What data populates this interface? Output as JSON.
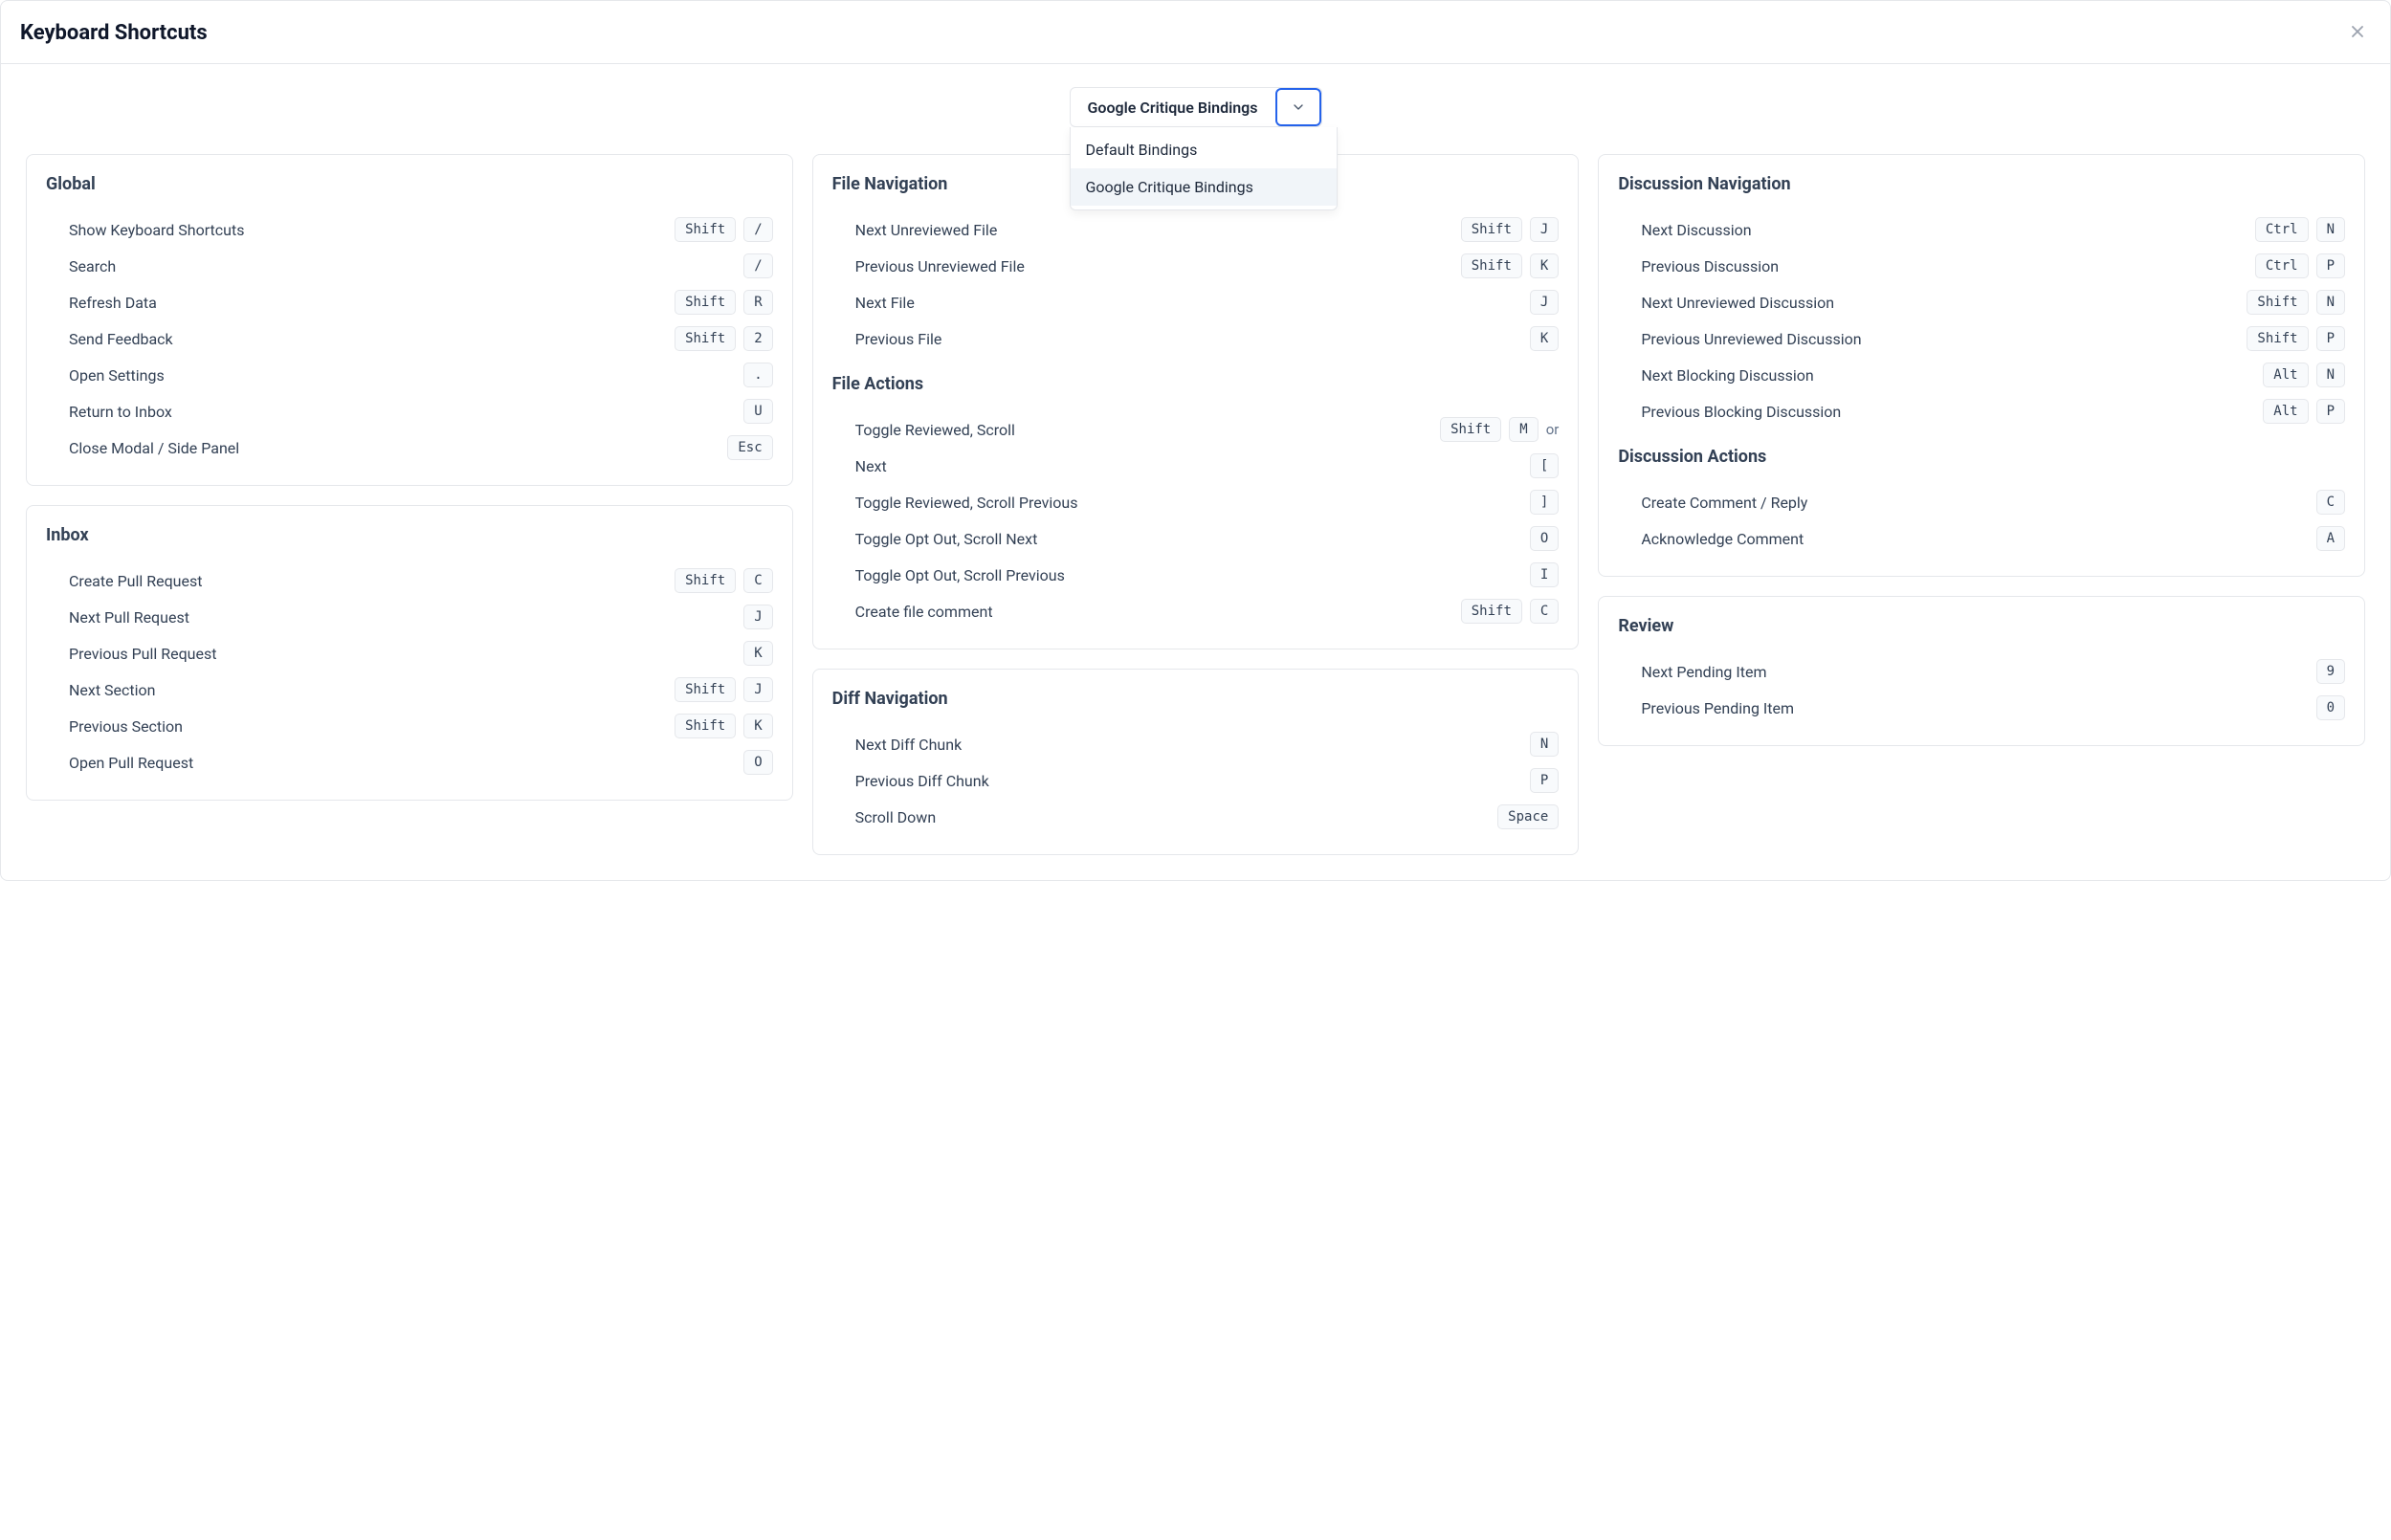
{
  "header": {
    "title": "Keyboard Shortcuts"
  },
  "dropdown": {
    "selected": "Google Critique Bindings",
    "options": [
      "Default Bindings",
      "Google Critique Bindings"
    ]
  },
  "columns": [
    [
      {
        "title": "Global",
        "rows": [
          {
            "label": "Show Keyboard Shortcuts",
            "keys": [
              "Shift",
              "/"
            ]
          },
          {
            "label": "Search",
            "keys": [
              "/"
            ]
          },
          {
            "label": "Refresh Data",
            "keys": [
              "Shift",
              "R"
            ]
          },
          {
            "label": "Send Feedback",
            "keys": [
              "Shift",
              "2"
            ]
          },
          {
            "label": "Open Settings",
            "keys": [
              "."
            ]
          },
          {
            "label": "Return to Inbox",
            "keys": [
              "U"
            ]
          },
          {
            "label": "Close Modal / Side Panel",
            "keys": [
              "Esc"
            ]
          }
        ]
      },
      {
        "title": "Inbox",
        "rows": [
          {
            "label": "Create Pull Request",
            "keys": [
              "Shift",
              "C"
            ]
          },
          {
            "label": "Next Pull Request",
            "keys": [
              "J"
            ]
          },
          {
            "label": "Previous Pull Request",
            "keys": [
              "K"
            ]
          },
          {
            "label": "Next Section",
            "keys": [
              "Shift",
              "J"
            ]
          },
          {
            "label": "Previous Section",
            "keys": [
              "Shift",
              "K"
            ]
          },
          {
            "label": "Open Pull Request",
            "keys": [
              "O"
            ]
          }
        ]
      }
    ],
    [
      {
        "groups": [
          {
            "title": "File Navigation",
            "rows": [
              {
                "label": "Next Unreviewed File",
                "keys": [
                  "Shift",
                  "J"
                ]
              },
              {
                "label": "Previous Unreviewed File",
                "keys": [
                  "Shift",
                  "K"
                ]
              },
              {
                "label": "Next File",
                "keys": [
                  "J"
                ]
              },
              {
                "label": "Previous File",
                "keys": [
                  "K"
                ]
              }
            ]
          },
          {
            "title": "File Actions",
            "rows": [
              {
                "label": "Toggle Reviewed, Scroll",
                "keys": [
                  "Shift",
                  "M"
                ],
                "suffix": "or"
              },
              {
                "label": "Next",
                "keys": [
                  "["
                ]
              },
              {
                "label": "Toggle Reviewed, Scroll Previous",
                "keys": [
                  "]"
                ]
              },
              {
                "label": "Toggle Opt Out, Scroll Next",
                "keys": [
                  "O"
                ]
              },
              {
                "label": "Toggle Opt Out, Scroll Previous",
                "keys": [
                  "I"
                ]
              },
              {
                "label": "Create file comment",
                "keys": [
                  "Shift",
                  "C"
                ]
              }
            ]
          }
        ]
      },
      {
        "title": "Diff Navigation",
        "rows": [
          {
            "label": "Next Diff Chunk",
            "keys": [
              "N"
            ]
          },
          {
            "label": "Previous Diff Chunk",
            "keys": [
              "P"
            ]
          },
          {
            "label": "Scroll Down",
            "keys": [
              "Space"
            ]
          }
        ]
      }
    ],
    [
      {
        "groups": [
          {
            "title": "Discussion Navigation",
            "rows": [
              {
                "label": "Next Discussion",
                "keys": [
                  "Ctrl",
                  "N"
                ]
              },
              {
                "label": "Previous Discussion",
                "keys": [
                  "Ctrl",
                  "P"
                ]
              },
              {
                "label": "Next Unreviewed Discussion",
                "keys": [
                  "Shift",
                  "N"
                ]
              },
              {
                "label": "Previous Unreviewed Discussion",
                "keys": [
                  "Shift",
                  "P"
                ]
              },
              {
                "label": "Next Blocking Discussion",
                "keys": [
                  "Alt",
                  "N"
                ]
              },
              {
                "label": "Previous Blocking Discussion",
                "keys": [
                  "Alt",
                  "P"
                ]
              }
            ]
          },
          {
            "title": "Discussion Actions",
            "rows": [
              {
                "label": "Create Comment / Reply",
                "keys": [
                  "C"
                ]
              },
              {
                "label": "Acknowledge Comment",
                "keys": [
                  "A"
                ]
              }
            ]
          }
        ]
      },
      {
        "title": "Review",
        "rows": [
          {
            "label": "Next Pending Item",
            "keys": [
              "9"
            ]
          },
          {
            "label": "Previous Pending Item",
            "keys": [
              "0"
            ]
          }
        ]
      }
    ]
  ]
}
